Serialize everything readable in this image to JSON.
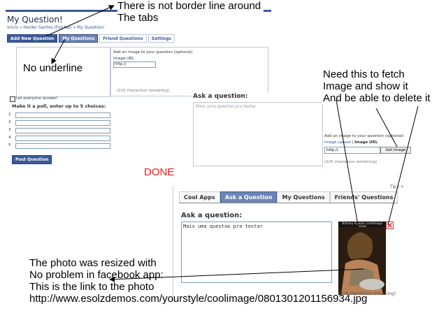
{
  "annotations": {
    "border_note_line1": "There is not border line around",
    "border_note_line2": "The tabs",
    "underline_note": "No underline",
    "fetch_note_line1": "Need this to fetch",
    "fetch_note_line2": "Image and show it",
    "fetch_note_line3": "And be able to delete it",
    "done_label": "DONE",
    "photo_note_line1": "The photo was resized with",
    "photo_note_line2": "No problem in facebook app:",
    "photo_note_line3": "This is the link to the photo",
    "photo_note_line4": "http://www.esolzdemos.com/yourstyle/coolimage/0801301201156934.jpg"
  },
  "shot1": {
    "title": "My Question!",
    "breadcrumb": "Inicio » Heider Santos (FoirAqu » My Question!",
    "tabs": [
      {
        "label": "Add New Question"
      },
      {
        "label": "My Questions"
      },
      {
        "label": "Friend Questions"
      },
      {
        "label": "Settings"
      }
    ],
    "image_label": "Add an image to your question (optional)",
    "image_url_label": "Image URL",
    "image_url_value": "http://",
    "chars_remaining": "(215 characters remaining)",
    "let_everyone_answer": "Let everyone answer!",
    "poll_label": "Make it a poll, enter up to 5 choices:",
    "poll_numbers": [
      "1",
      "2",
      "3",
      "4",
      "5"
    ],
    "post_button": "Post Question"
  },
  "shot2": {
    "ask_label": "Ask a question:",
    "textarea_text": "Mais uma questao pra testar",
    "image_label": "Add an image to your question (optional)",
    "image_upload_link": "Image upload",
    "separator": "|",
    "image_url_label": "Image URL",
    "image_url_value": "http://",
    "get_image_button": "Get Image",
    "chars_remaining": "(225 characters remaining)"
  },
  "shot3": {
    "tabs": [
      {
        "label": "Cool Apps"
      },
      {
        "label": "Ask a Question"
      },
      {
        "label": "My Questions"
      },
      {
        "label": "Friends' Questions"
      }
    ],
    "ask_label": "Ask a question:",
    "textarea_text": "Mais uma questao pra testar",
    "photo_caption": "Britney Spears coolimage 2008",
    "chars_remaining": "(228 characters remaining)",
    "top_right_fragment": "Tip / +"
  }
}
